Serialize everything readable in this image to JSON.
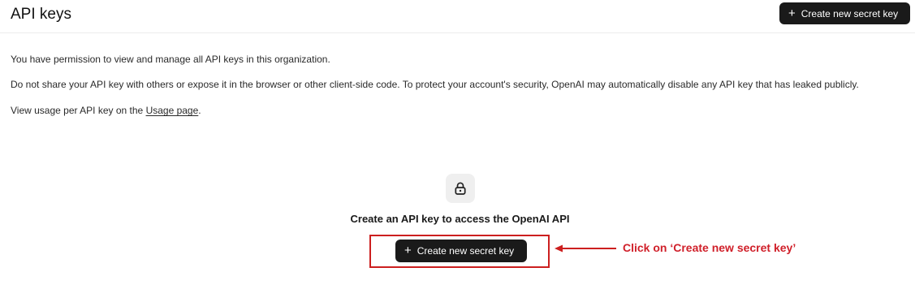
{
  "header": {
    "title": "API keys",
    "create_button_label": "Create new secret key"
  },
  "description": {
    "line1": "You have permission to view and manage all API keys in this organization.",
    "line2": "Do not share your API key with others or expose it in the browser or other client-side code. To protect your account's security, OpenAI may automatically disable any API key that has leaked publicly.",
    "line3_prefix": "View usage per API key on the ",
    "usage_link": "Usage page",
    "line3_suffix": "."
  },
  "empty_state": {
    "icon": "lock-icon",
    "heading": "Create an API key to access the OpenAI API",
    "button_label": "Create new secret key"
  },
  "annotation": {
    "text": "Click on ‘Create new secret key’",
    "color": "#d0202a"
  },
  "colors": {
    "button_bg": "#1a1a1a",
    "highlight": "#cc1f1f"
  }
}
